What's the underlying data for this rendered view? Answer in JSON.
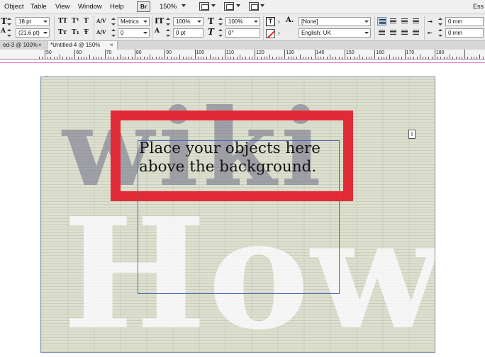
{
  "menubar": {
    "items": [
      "Object",
      "Table",
      "View",
      "Window",
      "Help"
    ],
    "bridge_label": "Br",
    "zoom": "150%",
    "right_text": "Ess"
  },
  "control": {
    "font_size": "18 pt",
    "leading": "(21.6 pt)",
    "kerning": "Metrics",
    "tracking": "0",
    "vertical_scale": "100%",
    "horizontal_scale": "100%",
    "baseline_shift": "0 pt",
    "skew": "0°",
    "char_style": "[None]",
    "language": "English: UK",
    "indent_left": "0 mm",
    "indent_right": "0 mm",
    "icons": {
      "size": "T",
      "allcaps": "TT",
      "super": "T¹",
      "small_caps": "Tт",
      "sub": "T₁",
      "strike": "Ŧ",
      "kern": "A/V",
      "vscale": "IT",
      "hscale": "T",
      "baseline": "A",
      "skew": "T",
      "char_a": "A."
    }
  },
  "tabs": [
    {
      "label": "ed-3 @ 100%",
      "close": "×"
    },
    {
      "label": "*Untitled-4 @ 150%",
      "close": "×"
    }
  ],
  "ruler": {
    "labels": [
      "50",
      "60",
      "70",
      "80",
      "90",
      "100",
      "110",
      "120",
      "130",
      "140",
      "150",
      "160",
      "170",
      "180"
    ]
  },
  "document": {
    "text_lines": [
      "Place your objects here",
      "above the background."
    ],
    "watermark_top": "wiki",
    "watermark_bottom": "How",
    "colors": {
      "frame": "#e02a36",
      "text_frame_border": "#4a6db0",
      "page_bg": "#dde0cf"
    }
  }
}
